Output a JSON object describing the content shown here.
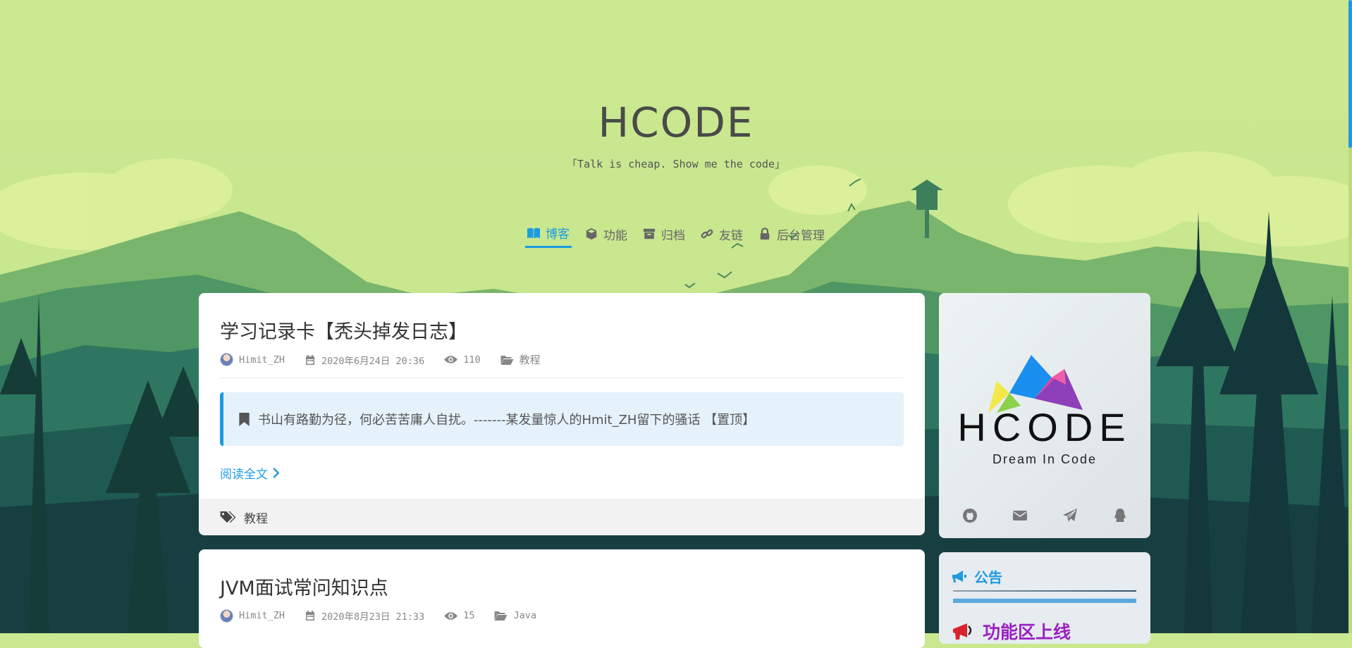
{
  "header": {
    "title": "HCODE",
    "subtitle": "「Talk is cheap. Show me the code」"
  },
  "nav": [
    {
      "label": "博客",
      "icon": "book-icon",
      "active": true
    },
    {
      "label": "功能",
      "icon": "cube-icon",
      "active": false
    },
    {
      "label": "归档",
      "icon": "archive-icon",
      "active": false
    },
    {
      "label": "友链",
      "icon": "link-icon",
      "active": false
    },
    {
      "label": "后台管理",
      "icon": "lock-icon",
      "active": false
    }
  ],
  "posts": [
    {
      "title": "学习记录卡【秃头掉发日志】",
      "author": "Himit_ZH",
      "date": "2020年6月24日 20:36",
      "views": "110",
      "category": "教程",
      "quote": "书山有路勤为径，何必苦苦庸人自扰。-------某发量惊人的Hmit_ZH留下的骚话 【置顶】",
      "read_more": "阅读全文",
      "tag": "教程"
    },
    {
      "title": "JVM面试常问知识点",
      "author": "Himit_ZH",
      "date": "2020年8月23日 21:33",
      "views": "15",
      "category": "Java"
    }
  ],
  "profile": {
    "logo_text": "HCODE",
    "tagline": "Dream In Code",
    "social_icons": [
      "github-icon",
      "mail-icon",
      "paper-plane-icon",
      "qq-icon"
    ]
  },
  "notice": {
    "title": "公告",
    "headline": "功能区上线"
  },
  "colors": {
    "accent": "#1e9be0",
    "sky": "#c9e88f",
    "notice_headline": "#9b1fc4"
  }
}
